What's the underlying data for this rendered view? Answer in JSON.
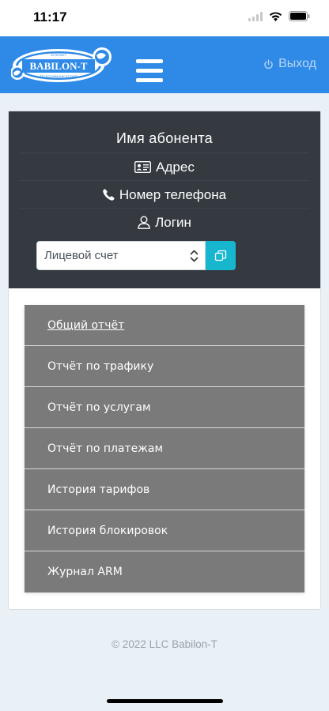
{
  "status": {
    "time": "11:17"
  },
  "header": {
    "logo_text": "BABILON-T",
    "logo_top": "INTERNET",
    "logo_bottom": "TELECOMMUNICATIONS",
    "logout_label": "Выход"
  },
  "profile": {
    "name": "Имя абонента",
    "address": "Адрес",
    "phone": "Номер телефона",
    "login": "Логин",
    "account_select": "Лицевой счет"
  },
  "menu": {
    "items": [
      {
        "label": "Общий отчёт"
      },
      {
        "label": "Отчёт по трафику"
      },
      {
        "label": "Отчёт по услугам"
      },
      {
        "label": "Отчёт по платежам"
      },
      {
        "label": "История тарифов"
      },
      {
        "label": "История блокировок"
      },
      {
        "label": "Журнал ARM"
      }
    ]
  },
  "footer": {
    "copyright": "© 2022 LLC Babilon-T"
  },
  "colors": {
    "navbar": "#2e8ae6",
    "profile_bg": "#343a40",
    "menu_bg": "#7a7a7a",
    "copy_button": "#17b6cf"
  }
}
